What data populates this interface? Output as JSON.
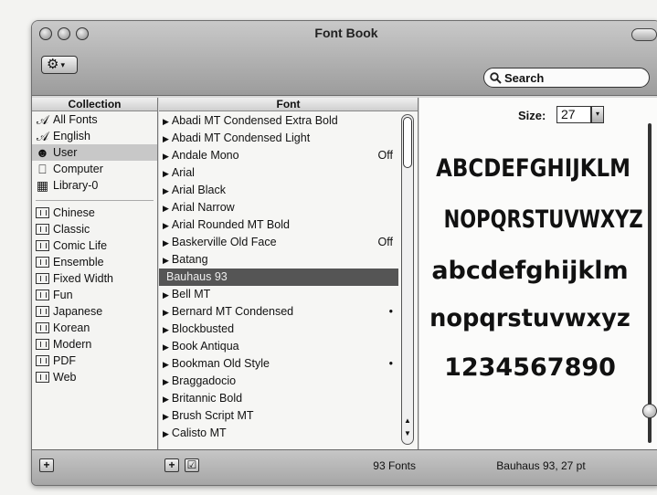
{
  "window": {
    "title": "Font Book"
  },
  "toolbar": {
    "action_icon": "gear-icon",
    "search_placeholder": "Search"
  },
  "collection": {
    "header": "Collection",
    "system_items": [
      {
        "label": "All Fonts",
        "icon": "all-fonts-icon"
      },
      {
        "label": "English",
        "icon": "all-fonts-icon"
      },
      {
        "label": "User",
        "icon": "user-icon",
        "selected": true
      },
      {
        "label": "Computer",
        "icon": "computer-icon"
      },
      {
        "label": "Library-0",
        "icon": "library-icon"
      }
    ],
    "collections": [
      "Chinese",
      "Classic",
      "Comic Life",
      "Ensemble",
      "Fixed Width",
      "Fun",
      "Japanese",
      "Korean",
      "Modern",
      "PDF",
      "Web"
    ]
  },
  "font": {
    "header": "Font",
    "items": [
      {
        "name": "Abadi MT Condensed Extra Bold",
        "flag": ""
      },
      {
        "name": "Abadi MT Condensed Light",
        "flag": ""
      },
      {
        "name": "Andale Mono",
        "flag": "Off"
      },
      {
        "name": "Arial",
        "flag": ""
      },
      {
        "name": "Arial Black",
        "flag": ""
      },
      {
        "name": "Arial Narrow",
        "flag": ""
      },
      {
        "name": "Arial Rounded MT Bold",
        "flag": ""
      },
      {
        "name": "Baskerville Old Face",
        "flag": "Off"
      },
      {
        "name": "Batang",
        "flag": ""
      },
      {
        "name": "Bauhaus 93",
        "flag": "",
        "selected": true
      },
      {
        "name": "Bell MT",
        "flag": ""
      },
      {
        "name": "Bernard MT Condensed",
        "flag": "•"
      },
      {
        "name": "Blockbusted",
        "flag": ""
      },
      {
        "name": "Book Antiqua",
        "flag": ""
      },
      {
        "name": "Bookman Old Style",
        "flag": "•"
      },
      {
        "name": "Braggadocio",
        "flag": ""
      },
      {
        "name": "Britannic Bold",
        "flag": ""
      },
      {
        "name": "Brush Script MT",
        "flag": ""
      },
      {
        "name": "Calisto MT",
        "flag": ""
      }
    ]
  },
  "preview": {
    "size_label": "Size:",
    "size_value": "27",
    "samples": [
      "ABCDEFGHIJKLM",
      "NOPQRSTUVWXYZ",
      "abcdefghijklm",
      "nopqrstuvwxyz",
      "1234567890"
    ],
    "size_slider_level": 0.9
  },
  "footer": {
    "add_collection": "+",
    "add_font": "+",
    "toggle_font": "☑",
    "font_count": "93 Fonts",
    "status": "Bauhaus 93, 27 pt"
  }
}
